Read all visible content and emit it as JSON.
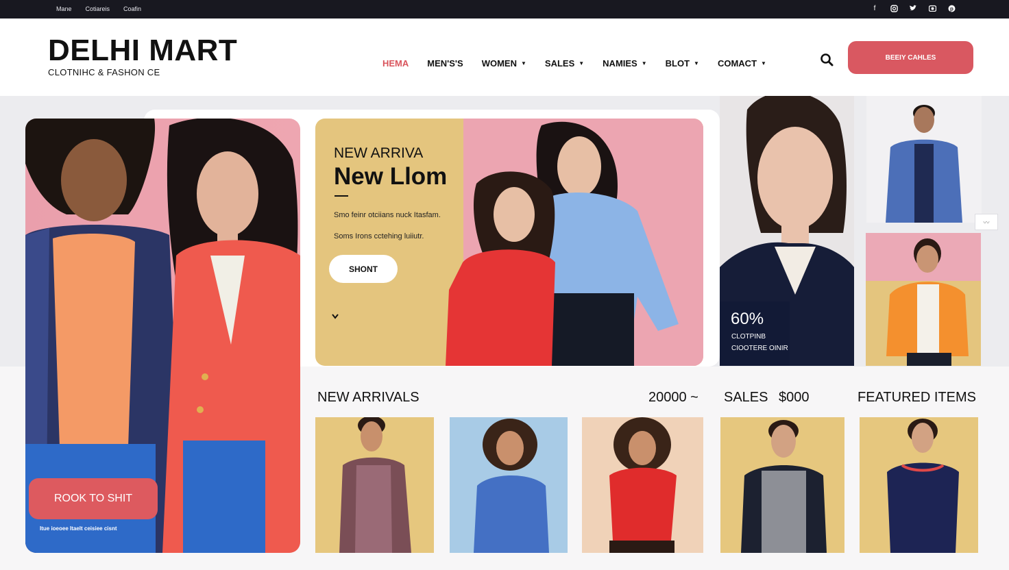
{
  "topbar": {
    "links": [
      "Mane",
      "Cotiareis",
      "Coafin"
    ],
    "social_icons": [
      "facebook-icon",
      "instagram-icon",
      "twitter-icon",
      "camera-icon",
      "pinterest-icon"
    ]
  },
  "header": {
    "logo": "DELHI MART",
    "tagline": "CLOTNIHC & FASHON CE",
    "nav": [
      {
        "label": "HEMA",
        "dropdown": false,
        "active": true
      },
      {
        "label": "MEN'S'S",
        "dropdown": false,
        "active": false
      },
      {
        "label": "WOMEN",
        "dropdown": true,
        "active": false
      },
      {
        "label": "SALES",
        "dropdown": true,
        "active": false
      },
      {
        "label": "NAMIES",
        "dropdown": true,
        "active": false
      },
      {
        "label": "BLOT",
        "dropdown": true,
        "active": false
      },
      {
        "label": "COMACT",
        "dropdown": true,
        "active": false
      }
    ],
    "cta_label": "BEEIY CAHLES"
  },
  "hero_left": {
    "button_label": "ROOK TO SHIT",
    "note": "Itue ioeoee Itaelt ceisiee cisnt"
  },
  "promo": {
    "eyebrow": "NEW ARRIVA",
    "title": "New Llom",
    "line1": "Smo feinr otciians nuck Itasfam.",
    "line2": "Soms Irons cctehing luiiutr.",
    "button_label": "SHONT"
  },
  "sale_card": {
    "percent": "60%",
    "line1": "CLOTPINB",
    "line2": "CIOOTERE OINIR"
  },
  "sections": {
    "new_arrivals": "NEW ARRIVALS",
    "range": "20000 ~",
    "sales": "SALES",
    "sales_price": "$000",
    "featured": "FEATURED ITEMS"
  },
  "colors": {
    "accent": "#d95861",
    "pink": "#eca5b1",
    "mustard": "#e4c57e",
    "navy": "#121a36",
    "topbar": "#181820"
  }
}
